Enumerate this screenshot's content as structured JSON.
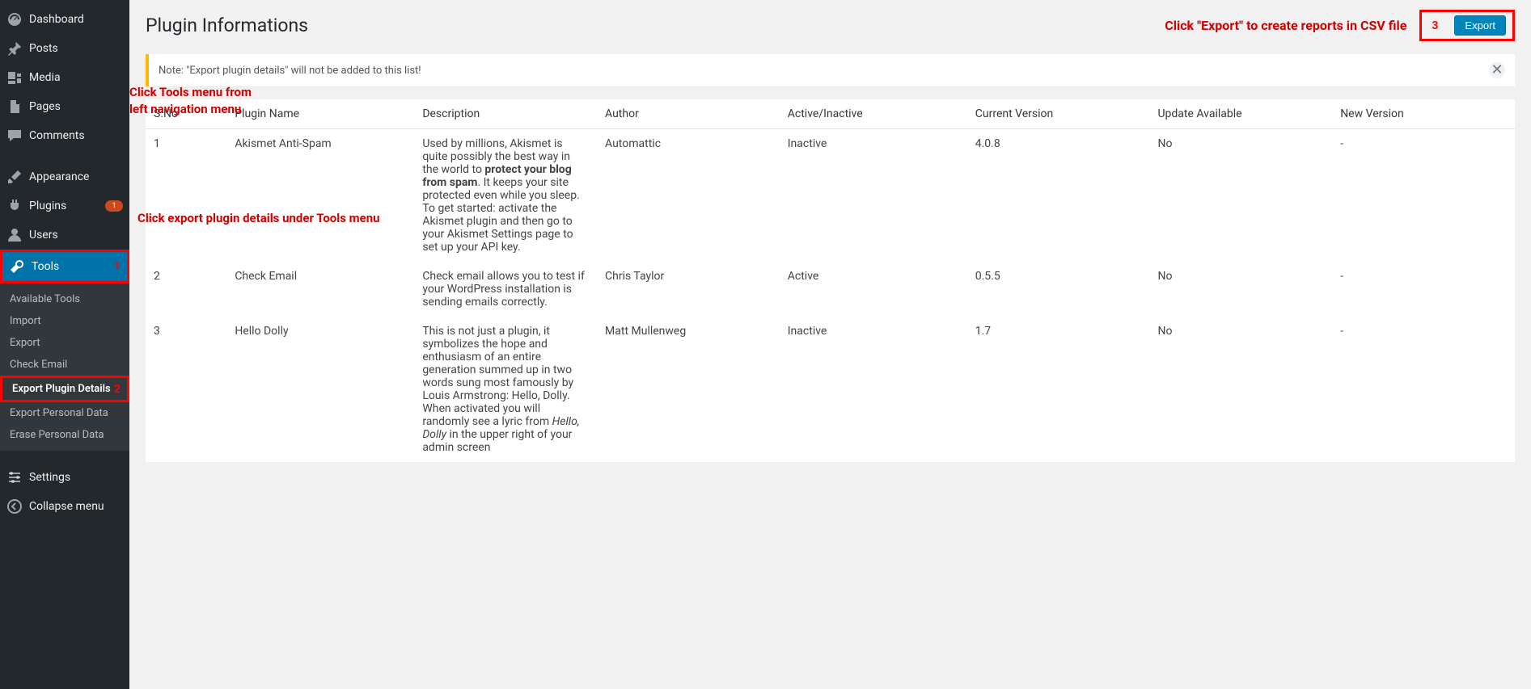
{
  "sidebar": {
    "menu": [
      {
        "label": "Dashboard",
        "icon": "dashboard"
      },
      {
        "label": "Posts",
        "icon": "pin"
      },
      {
        "label": "Media",
        "icon": "media"
      },
      {
        "label": "Pages",
        "icon": "pages"
      },
      {
        "label": "Comments",
        "icon": "comment"
      }
    ],
    "menu2": [
      {
        "label": "Appearance",
        "icon": "brush"
      },
      {
        "label": "Plugins",
        "icon": "plug",
        "badge": "1"
      },
      {
        "label": "Users",
        "icon": "user"
      }
    ],
    "tools_label": "Tools",
    "submenu": [
      {
        "label": "Available Tools"
      },
      {
        "label": "Import"
      },
      {
        "label": "Export"
      },
      {
        "label": "Check Email"
      },
      {
        "label": "Export Plugin Details",
        "current": true
      },
      {
        "label": "Export Personal Data"
      },
      {
        "label": "Erase Personal Data"
      }
    ],
    "menu3": [
      {
        "label": "Settings",
        "icon": "sliders"
      }
    ],
    "collapse_label": "Collapse menu"
  },
  "annotations": {
    "num1": "1",
    "text1": "Click Tools menu from left navigation menu",
    "num2": "2",
    "text2": "Click export plugin details under Tools menu",
    "num3": "3",
    "text3": "Click \"Export\" to create reports in CSV file"
  },
  "header": {
    "title": "Plugin Informations",
    "export_label": "Export"
  },
  "notice": {
    "text": "Note: \"Export plugin details\" will not be added to this list!"
  },
  "table": {
    "columns": [
      "S.No",
      "Plugin Name",
      "Description",
      "Author",
      "Active/Inactive",
      "Current Version",
      "Update Available",
      "New Version"
    ],
    "rows": [
      {
        "sno": "1",
        "name": "Akismet Anti-Spam",
        "description_html": "Used by millions, Akismet is quite possibly the best way in the world to <b>protect your blog from spam</b>. It keeps your site protected even while you sleep. To get started: activate the Akismet plugin and then go to your Akismet Settings page to set up your API key.",
        "author": "Automattic",
        "status": "Inactive",
        "version": "4.0.8",
        "update": "No",
        "newver": "-"
      },
      {
        "sno": "2",
        "name": "Check Email",
        "description_html": "Check email allows you to test if your WordPress installation is sending emails correctly.",
        "author": "Chris Taylor",
        "status": "Active",
        "version": "0.5.5",
        "update": "No",
        "newver": "-"
      },
      {
        "sno": "3",
        "name": "Hello Dolly",
        "description_html": "This is not just a plugin, it symbolizes the hope and enthusiasm of an entire generation summed up in two words sung most famously by Louis Armstrong: Hello, Dolly. When activated you will randomly see a lyric from <i>Hello, Dolly</i> in the upper right of your admin screen",
        "author": "Matt Mullenweg",
        "status": "Inactive",
        "version": "1.7",
        "update": "No",
        "newver": "-"
      }
    ]
  }
}
